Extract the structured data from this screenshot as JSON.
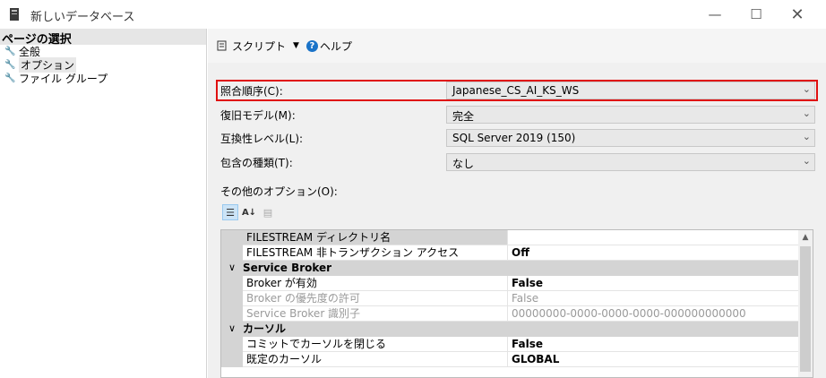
{
  "window": {
    "title": "新しいデータベース",
    "controls": {
      "minimize": "—",
      "maximize": "☐",
      "close": "✕"
    }
  },
  "left": {
    "header": "ページの選択",
    "items": [
      {
        "label": "全般",
        "icon": "wrench-icon"
      },
      {
        "label": "オプション",
        "icon": "wrench-icon",
        "selected": true
      },
      {
        "label": "ファイル グループ",
        "icon": "wrench-icon"
      }
    ]
  },
  "toolbar": {
    "script_label": "スクリプト",
    "script_dropdown": "▼",
    "help_label": "ヘルプ"
  },
  "form": {
    "collation": {
      "label": "照合順序(C):",
      "value": "Japanese_CS_AI_KS_WS"
    },
    "recovery": {
      "label": "復旧モデル(M):",
      "value": "完全"
    },
    "compat": {
      "label": "互換性レベル(L):",
      "value": "SQL Server 2019 (150)"
    },
    "containment": {
      "label": "包含の種類(T):",
      "value": "なし"
    },
    "other_options": "その他のオプション(O):"
  },
  "grid_tools": [
    "categorized-icon",
    "alphabetical-icon",
    "property-pages-icon"
  ],
  "property_grid": {
    "rows": [
      {
        "type": "prop",
        "name": "FILESTREAM ディレクトリ名",
        "value": "",
        "selected": true
      },
      {
        "type": "prop",
        "name": "FILESTREAM 非トランザクション アクセス",
        "value": "Off",
        "bold": true
      },
      {
        "type": "category",
        "name": "Service Broker"
      },
      {
        "type": "prop",
        "name": "Broker が有効",
        "value": "False",
        "bold": true
      },
      {
        "type": "prop",
        "name": "Broker の優先度の許可",
        "value": "False",
        "disabled": true
      },
      {
        "type": "prop",
        "name": "Service Broker 識別子",
        "value": "00000000-0000-0000-0000-000000000000",
        "disabled": true
      },
      {
        "type": "category",
        "name": "カーソル"
      },
      {
        "type": "prop",
        "name": "コミットでカーソルを閉じる",
        "value": "False",
        "bold": true
      },
      {
        "type": "prop",
        "name": "既定のカーソル",
        "value": "GLOBAL",
        "bold": true
      }
    ]
  },
  "colors": {
    "highlight_border": "#e01010",
    "help_icon": "#1a73c8"
  }
}
